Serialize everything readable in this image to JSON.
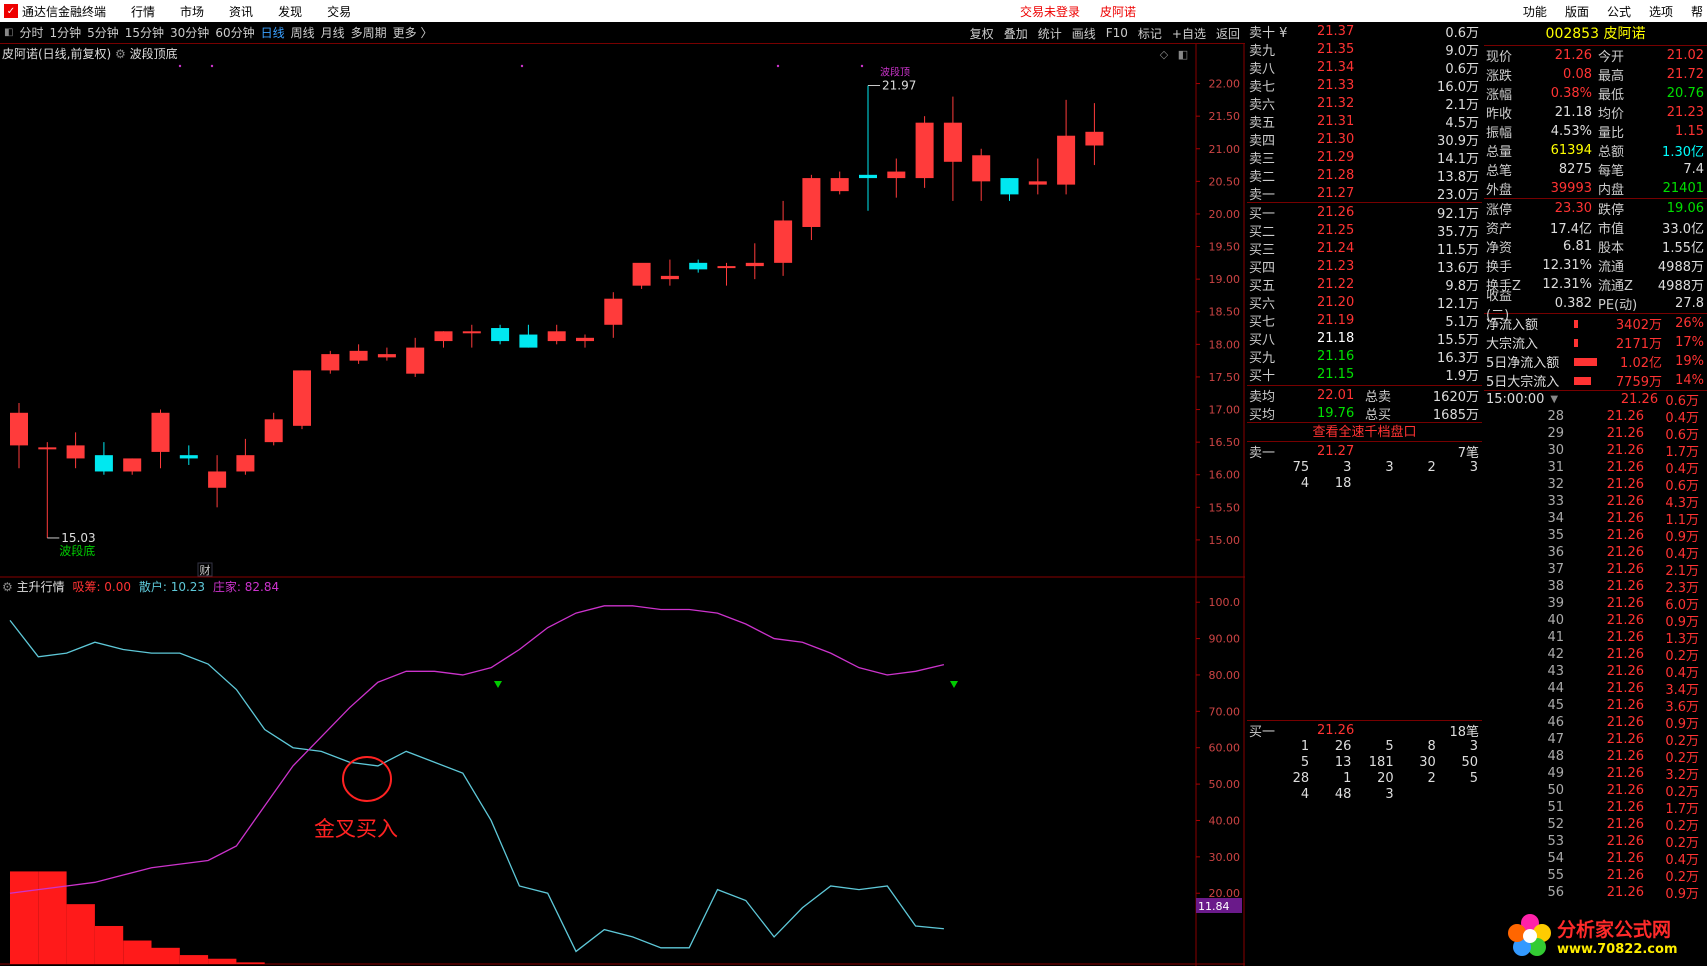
{
  "menubar": {
    "app_title": "通达信金融终端",
    "items": [
      "行情",
      "市场",
      "资讯",
      "发现",
      "交易"
    ],
    "login_status": "交易未登录",
    "stock_name": "皮阿诺",
    "right_items": [
      "功能",
      "版面",
      "公式",
      "选项",
      "帮"
    ]
  },
  "toolbar": {
    "periods": [
      "分时",
      "1分钟",
      "5分钟",
      "15分钟",
      "30分钟",
      "60分钟",
      "日线",
      "周线",
      "月线",
      "多周期",
      "更多 〉"
    ],
    "active_period": "日线",
    "tools": [
      "复权",
      "叠加",
      "统计",
      "画线",
      "F10",
      "标记",
      "+自选",
      "返回"
    ]
  },
  "chart_title": {
    "name": "皮阿诺(日线,前复权)",
    "indicator": "波段顶底"
  },
  "indicator_title": {
    "name": "主升行情",
    "xichou_label": "吸筹: 0.00",
    "sanhu_label": "散户: 10.23",
    "zhuangjia_label": "庄家: 82.84"
  },
  "annotations": {
    "high_label": "21.97",
    "low_label": "15.03",
    "low_marker": "波段底",
    "top_marker": "波段顶",
    "fin_marker": "财",
    "cross_text": "金叉买入",
    "current_value": "11.84"
  },
  "chart_data": [
    {
      "type": "candlestick",
      "ylim": [
        14.6,
        22.3
      ],
      "ticks": [
        "22.00",
        "21.50",
        "21.00",
        "20.50",
        "20.00",
        "19.50",
        "19.00",
        "18.50",
        "18.00",
        "17.50",
        "17.00",
        "16.50",
        "16.00",
        "15.50",
        "15.00"
      ],
      "tick_values": [
        22,
        21.5,
        21,
        20.5,
        20,
        19.5,
        19,
        18.5,
        18,
        17.5,
        17,
        16.5,
        16,
        15.5,
        15
      ],
      "candles": [
        [
          16.45,
          17.1,
          16.1,
          16.95
        ],
        [
          16.4,
          16.5,
          15.03,
          16.42
        ],
        [
          16.25,
          16.65,
          16.1,
          16.45
        ],
        [
          16.3,
          16.5,
          16.0,
          16.05
        ],
        [
          16.05,
          16.25,
          16.0,
          16.25
        ],
        [
          16.35,
          17.0,
          16.1,
          16.95
        ],
        [
          16.3,
          16.45,
          16.15,
          16.25
        ],
        [
          15.8,
          16.3,
          15.5,
          16.05
        ],
        [
          16.05,
          16.55,
          16.0,
          16.3
        ],
        [
          16.5,
          16.95,
          16.45,
          16.85
        ],
        [
          16.75,
          17.6,
          16.7,
          17.6
        ],
        [
          17.6,
          17.9,
          17.55,
          17.85
        ],
        [
          17.75,
          18.0,
          17.7,
          17.9
        ],
        [
          17.8,
          17.95,
          17.75,
          17.85
        ],
        [
          17.55,
          18.1,
          17.5,
          17.95
        ],
        [
          18.05,
          18.2,
          17.95,
          18.2
        ],
        [
          18.2,
          18.3,
          17.95,
          18.2
        ],
        [
          18.25,
          18.3,
          18.0,
          18.05
        ],
        [
          18.15,
          18.3,
          17.95,
          17.95
        ],
        [
          18.05,
          18.3,
          18.0,
          18.2
        ],
        [
          18.05,
          18.15,
          17.95,
          18.1
        ],
        [
          18.3,
          18.8,
          18.1,
          18.7
        ],
        [
          18.9,
          19.2,
          18.85,
          19.25
        ],
        [
          19.0,
          19.3,
          18.9,
          19.05
        ],
        [
          19.25,
          19.3,
          19.1,
          19.15
        ],
        [
          19.2,
          19.25,
          18.9,
          19.2
        ],
        [
          19.2,
          19.55,
          19.0,
          19.25
        ],
        [
          19.25,
          20.2,
          19.05,
          19.9
        ],
        [
          19.8,
          20.6,
          19.6,
          20.55
        ],
        [
          20.35,
          20.65,
          20.3,
          20.55
        ],
        [
          20.6,
          21.97,
          20.05,
          20.55
        ],
        [
          20.55,
          20.85,
          20.25,
          20.65
        ],
        [
          20.55,
          21.5,
          20.4,
          21.4
        ],
        [
          20.8,
          21.8,
          20.2,
          21.4
        ],
        [
          20.5,
          21.0,
          20.2,
          20.9
        ],
        [
          20.55,
          20.55,
          20.2,
          20.3
        ],
        [
          20.45,
          20.85,
          20.3,
          20.5
        ],
        [
          20.45,
          21.75,
          20.3,
          21.2
        ],
        [
          21.05,
          21.7,
          20.75,
          21.26
        ]
      ]
    },
    {
      "type": "line",
      "ylim": [
        0,
        105
      ],
      "ticks": [
        "100.0",
        "90.00",
        "80.00",
        "70.00",
        "60.00",
        "50.00",
        "40.00",
        "30.00",
        "20.00"
      ],
      "tick_values": [
        100,
        90,
        80,
        70,
        60,
        50,
        40,
        30,
        20
      ],
      "series": [
        {
          "name": "散户",
          "color": "#5ec8d8",
          "values": [
            95,
            85,
            86,
            89,
            87,
            86,
            86,
            83,
            76,
            65,
            60,
            59,
            56,
            55,
            59,
            56,
            53,
            40,
            22,
            20,
            4,
            10,
            8,
            5,
            5,
            21,
            18,
            8,
            16,
            22,
            21,
            22,
            11,
            10.23
          ]
        },
        {
          "name": "庄家",
          "color": "#cc33cc",
          "values": [
            20,
            21,
            22,
            23,
            25,
            27,
            28,
            29,
            33,
            44,
            55,
            63,
            71,
            78,
            81,
            81,
            80,
            82,
            87,
            93,
            97,
            99,
            99,
            98,
            98,
            97,
            94,
            90,
            89,
            86,
            82,
            80,
            81,
            82.84
          ]
        }
      ],
      "histogram": [
        26,
        26,
        17,
        11,
        7,
        5,
        3,
        2,
        1
      ]
    }
  ],
  "orderbook": {
    "sell": [
      {
        "label": "卖十 ¥",
        "price": "21.37",
        "vol": "0.6万"
      },
      {
        "label": "卖九",
        "price": "21.35",
        "vol": "9.0万"
      },
      {
        "label": "卖八",
        "price": "21.34",
        "vol": "0.6万"
      },
      {
        "label": "卖七",
        "price": "21.33",
        "vol": "16.0万"
      },
      {
        "label": "卖六",
        "price": "21.32",
        "vol": "2.1万"
      },
      {
        "label": "卖五",
        "price": "21.31",
        "vol": "4.5万"
      },
      {
        "label": "卖四",
        "price": "21.30",
        "vol": "30.9万"
      },
      {
        "label": "卖三",
        "price": "21.29",
        "vol": "14.1万"
      },
      {
        "label": "卖二",
        "price": "21.28",
        "vol": "13.8万"
      },
      {
        "label": "卖一",
        "price": "21.27",
        "vol": "23.0万"
      }
    ],
    "buy": [
      {
        "label": "买一",
        "price": "21.26",
        "vol": "92.1万"
      },
      {
        "label": "买二",
        "price": "21.25",
        "vol": "35.7万"
      },
      {
        "label": "买三",
        "price": "21.24",
        "vol": "11.5万"
      },
      {
        "label": "买四",
        "price": "21.23",
        "vol": "13.6万"
      },
      {
        "label": "买五",
        "price": "21.22",
        "vol": "9.8万"
      },
      {
        "label": "买六",
        "price": "21.20",
        "vol": "12.1万"
      },
      {
        "label": "买七",
        "price": "21.19",
        "vol": "5.1万"
      },
      {
        "label": "买八",
        "price": "21.18",
        "vol": "15.5万"
      },
      {
        "label": "买九",
        "price": "21.16",
        "vol": "16.3万"
      },
      {
        "label": "买十",
        "price": "21.15",
        "vol": "1.9万"
      }
    ],
    "avg_sell_label": "卖均",
    "avg_sell": "22.01",
    "total_sell_label": "总卖",
    "total_sell": "1620万",
    "avg_buy_label": "买均",
    "avg_buy": "19.76",
    "total_buy_label": "总买",
    "total_buy": "1685万",
    "full_depth_link": "查看全速千档盘口",
    "queue_sell_label": "卖一",
    "queue_sell_price": "21.27",
    "queue_sell_count": "7笔",
    "queue_sell_rows": [
      [
        "75",
        "3",
        "3",
        "2",
        "3"
      ],
      [
        "4",
        "18",
        "",
        "",
        ""
      ]
    ],
    "queue_buy_label": "买一",
    "queue_buy_price": "21.26",
    "queue_buy_count": "18笔",
    "queue_buy_rows": [
      [
        "1",
        "26",
        "5",
        "8",
        "3"
      ],
      [
        "5",
        "13",
        "181",
        "30",
        "50"
      ],
      [
        "28",
        "1",
        "20",
        "2",
        "5"
      ],
      [
        "4",
        "48",
        "3",
        "",
        ""
      ]
    ]
  },
  "info": {
    "code_title": "002853 皮阿诺",
    "rows": [
      [
        "现价",
        "21.26",
        "今开",
        "21.02"
      ],
      [
        "涨跌",
        "0.08",
        "最高",
        "21.72"
      ],
      [
        "涨幅",
        "0.38%",
        "最低",
        "20.76"
      ],
      [
        "昨收",
        "21.18",
        "均价",
        "21.23"
      ],
      [
        "振幅",
        "4.53%",
        "量比",
        "1.15"
      ],
      [
        "总量",
        "61394",
        "总额",
        "1.30亿"
      ],
      [
        "总笔",
        "8275",
        "每笔",
        "7.4"
      ],
      [
        "外盘",
        "39993",
        "内盘",
        "21401"
      ]
    ],
    "rows2": [
      [
        "涨停",
        "23.30",
        "跌停",
        "19.06"
      ],
      [
        "资产",
        "17.4亿",
        "市值",
        "33.0亿"
      ],
      [
        "净资",
        "6.81",
        "股本",
        "1.55亿"
      ],
      [
        "换手",
        "12.31%",
        "流通",
        "4988万"
      ],
      [
        "换手Z",
        "12.31%",
        "流通Z",
        "4988万"
      ],
      [
        "收益(二)",
        "0.382",
        "PE(动)",
        "27.8"
      ]
    ],
    "flows": [
      {
        "label": "净流入额",
        "value": "3402万",
        "pct": "26%",
        "bar": 0.15
      },
      {
        "label": "大宗流入",
        "value": "2171万",
        "pct": "17%",
        "bar": 0.12
      },
      {
        "label": "5日净流入额",
        "value": "1.02亿",
        "pct": "19%",
        "bar": 0.9
      },
      {
        "label": "5日大宗流入",
        "value": "7759万",
        "pct": "14%",
        "bar": 0.65
      }
    ],
    "tick_time": "15:00:00",
    "ticks": [
      [
        "28",
        "21.26",
        "0.4万"
      ],
      [
        "29",
        "21.26",
        "0.6万"
      ],
      [
        "30",
        "21.26",
        "1.7万"
      ],
      [
        "31",
        "21.26",
        "0.4万"
      ],
      [
        "32",
        "21.26",
        "0.6万"
      ],
      [
        "33",
        "21.26",
        "4.3万"
      ],
      [
        "34",
        "21.26",
        "1.1万"
      ],
      [
        "35",
        "21.26",
        "0.9万"
      ],
      [
        "36",
        "21.26",
        "0.4万"
      ],
      [
        "37",
        "21.26",
        "2.1万"
      ],
      [
        "38",
        "21.26",
        "2.3万"
      ],
      [
        "39",
        "21.26",
        "6.0万"
      ],
      [
        "40",
        "21.26",
        "0.9万"
      ],
      [
        "41",
        "21.26",
        "1.3万"
      ],
      [
        "42",
        "21.26",
        "0.2万"
      ],
      [
        "43",
        "21.26",
        "0.4万"
      ],
      [
        "44",
        "21.26",
        "3.4万"
      ],
      [
        "45",
        "21.26",
        "3.6万"
      ],
      [
        "46",
        "21.26",
        "0.9万"
      ],
      [
        "47",
        "21.26",
        "0.2万"
      ],
      [
        "48",
        "21.26",
        "0.2万"
      ],
      [
        "49",
        "21.26",
        "3.2万"
      ],
      [
        "50",
        "21.26",
        "0.2万"
      ],
      [
        "51",
        "21.26",
        "1.7万"
      ],
      [
        "52",
        "21.26",
        "0.2万"
      ],
      [
        "53",
        "21.26",
        "0.2万"
      ],
      [
        "54",
        "21.26",
        "0.4万"
      ],
      [
        "55",
        "21.26",
        "0.2万"
      ],
      [
        "56",
        "21.26",
        "0.9万"
      ]
    ],
    "first_tick_vol": "0.6万",
    "first_tick_price": "21.26"
  },
  "watermark": {
    "name": "分析家公式网",
    "url": "www.70822.com"
  }
}
